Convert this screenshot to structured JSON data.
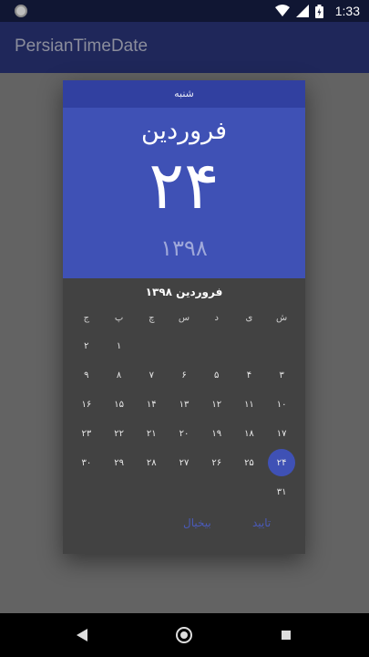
{
  "status_bar": {
    "time": "1:33"
  },
  "app": {
    "title": "PersianTimeDate"
  },
  "dialog": {
    "weekday_name": "شنبه",
    "header_month": "فروردین",
    "header_day": "۲۴",
    "header_year": "۱۳۹۸",
    "month_title": "فروردین ۱۳۹۸",
    "weekdays": [
      "ش",
      "ی",
      "د",
      "س",
      "چ",
      "پ",
      "ج"
    ],
    "weeks": [
      [
        "",
        "",
        "",
        "",
        "",
        "۱",
        "۲"
      ],
      [
        "۳",
        "۴",
        "۵",
        "۶",
        "۷",
        "۸",
        "۹"
      ],
      [
        "۱۰",
        "۱۱",
        "۱۲",
        "۱۳",
        "۱۴",
        "۱۵",
        "۱۶"
      ],
      [
        "۱۷",
        "۱۸",
        "۱۹",
        "۲۰",
        "۲۱",
        "۲۲",
        "۲۳"
      ],
      [
        "۲۴",
        "۲۵",
        "۲۶",
        "۲۷",
        "۲۸",
        "۲۹",
        "۳۰"
      ],
      [
        "۳۱",
        "",
        "",
        "",
        "",
        "",
        ""
      ]
    ],
    "selected_day": "۲۴",
    "ok_label": "تایید",
    "cancel_label": "بیخیال"
  },
  "colors": {
    "accent": "#3f51b5",
    "app_bar": "#1f275a",
    "dialog_bg": "#424242"
  }
}
